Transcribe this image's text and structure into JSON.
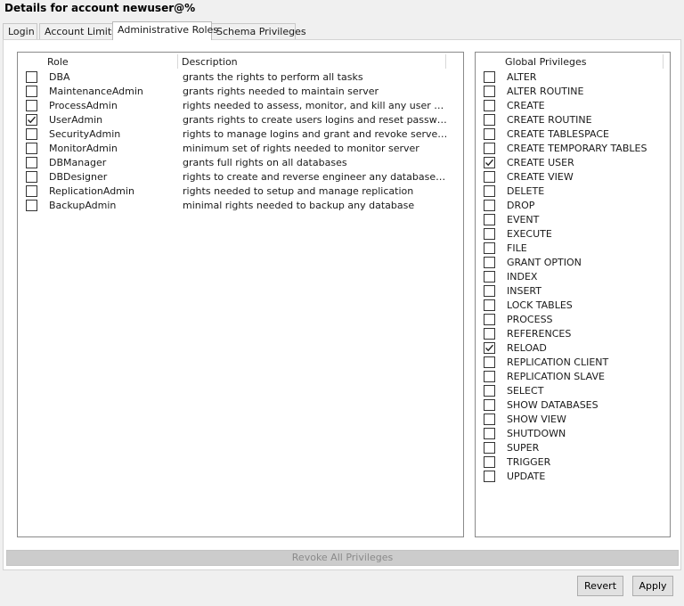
{
  "window": {
    "title": "Details for account newuser@%"
  },
  "tabs": [
    {
      "label": "Login",
      "active": false
    },
    {
      "label": "Account Limits",
      "active": false
    },
    {
      "label": "Administrative Roles",
      "active": true
    },
    {
      "label": "Schema Privileges",
      "active": false
    }
  ],
  "roles_table": {
    "headers": {
      "role": "Role",
      "description": "Description"
    },
    "rows": [
      {
        "role": "DBA",
        "description": "grants the rights to perform all tasks",
        "checked": false
      },
      {
        "role": "MaintenanceAdmin",
        "description": "grants rights needed to maintain server",
        "checked": false
      },
      {
        "role": "ProcessAdmin",
        "description": "rights needed to assess, monitor, and kill any user proce...",
        "checked": false
      },
      {
        "role": "UserAdmin",
        "description": "grants rights to create users logins and reset passwords",
        "checked": true
      },
      {
        "role": "SecurityAdmin",
        "description": "rights to manage logins and grant and revoke server an...",
        "checked": false
      },
      {
        "role": "MonitorAdmin",
        "description": "minimum set of rights needed to monitor server",
        "checked": false
      },
      {
        "role": "DBManager",
        "description": "grants full rights on all databases",
        "checked": false
      },
      {
        "role": "DBDesigner",
        "description": "rights to create and reverse engineer any database sche...",
        "checked": false
      },
      {
        "role": "ReplicationAdmin",
        "description": "rights needed to setup and manage replication",
        "checked": false
      },
      {
        "role": "BackupAdmin",
        "description": "minimal rights needed to backup any database",
        "checked": false
      }
    ]
  },
  "privileges_table": {
    "header": "Global Privileges",
    "rows": [
      {
        "name": "ALTER",
        "checked": false
      },
      {
        "name": "ALTER ROUTINE",
        "checked": false
      },
      {
        "name": "CREATE",
        "checked": false
      },
      {
        "name": "CREATE ROUTINE",
        "checked": false
      },
      {
        "name": "CREATE TABLESPACE",
        "checked": false
      },
      {
        "name": "CREATE TEMPORARY TABLES",
        "checked": false
      },
      {
        "name": "CREATE USER",
        "checked": true
      },
      {
        "name": "CREATE VIEW",
        "checked": false
      },
      {
        "name": "DELETE",
        "checked": false
      },
      {
        "name": "DROP",
        "checked": false
      },
      {
        "name": "EVENT",
        "checked": false
      },
      {
        "name": "EXECUTE",
        "checked": false
      },
      {
        "name": "FILE",
        "checked": false
      },
      {
        "name": "GRANT OPTION",
        "checked": false
      },
      {
        "name": "INDEX",
        "checked": false
      },
      {
        "name": "INSERT",
        "checked": false
      },
      {
        "name": "LOCK TABLES",
        "checked": false
      },
      {
        "name": "PROCESS",
        "checked": false
      },
      {
        "name": "REFERENCES",
        "checked": false
      },
      {
        "name": "RELOAD",
        "checked": true
      },
      {
        "name": "REPLICATION CLIENT",
        "checked": false
      },
      {
        "name": "REPLICATION SLAVE",
        "checked": false
      },
      {
        "name": "SELECT",
        "checked": false
      },
      {
        "name": "SHOW DATABASES",
        "checked": false
      },
      {
        "name": "SHOW VIEW",
        "checked": false
      },
      {
        "name": "SHUTDOWN",
        "checked": false
      },
      {
        "name": "SUPER",
        "checked": false
      },
      {
        "name": "TRIGGER",
        "checked": false
      },
      {
        "name": "UPDATE",
        "checked": false
      }
    ]
  },
  "buttons": {
    "revoke_all": {
      "label": "Revoke All Privileges",
      "enabled": false
    },
    "revert": "Revert",
    "apply": "Apply"
  }
}
